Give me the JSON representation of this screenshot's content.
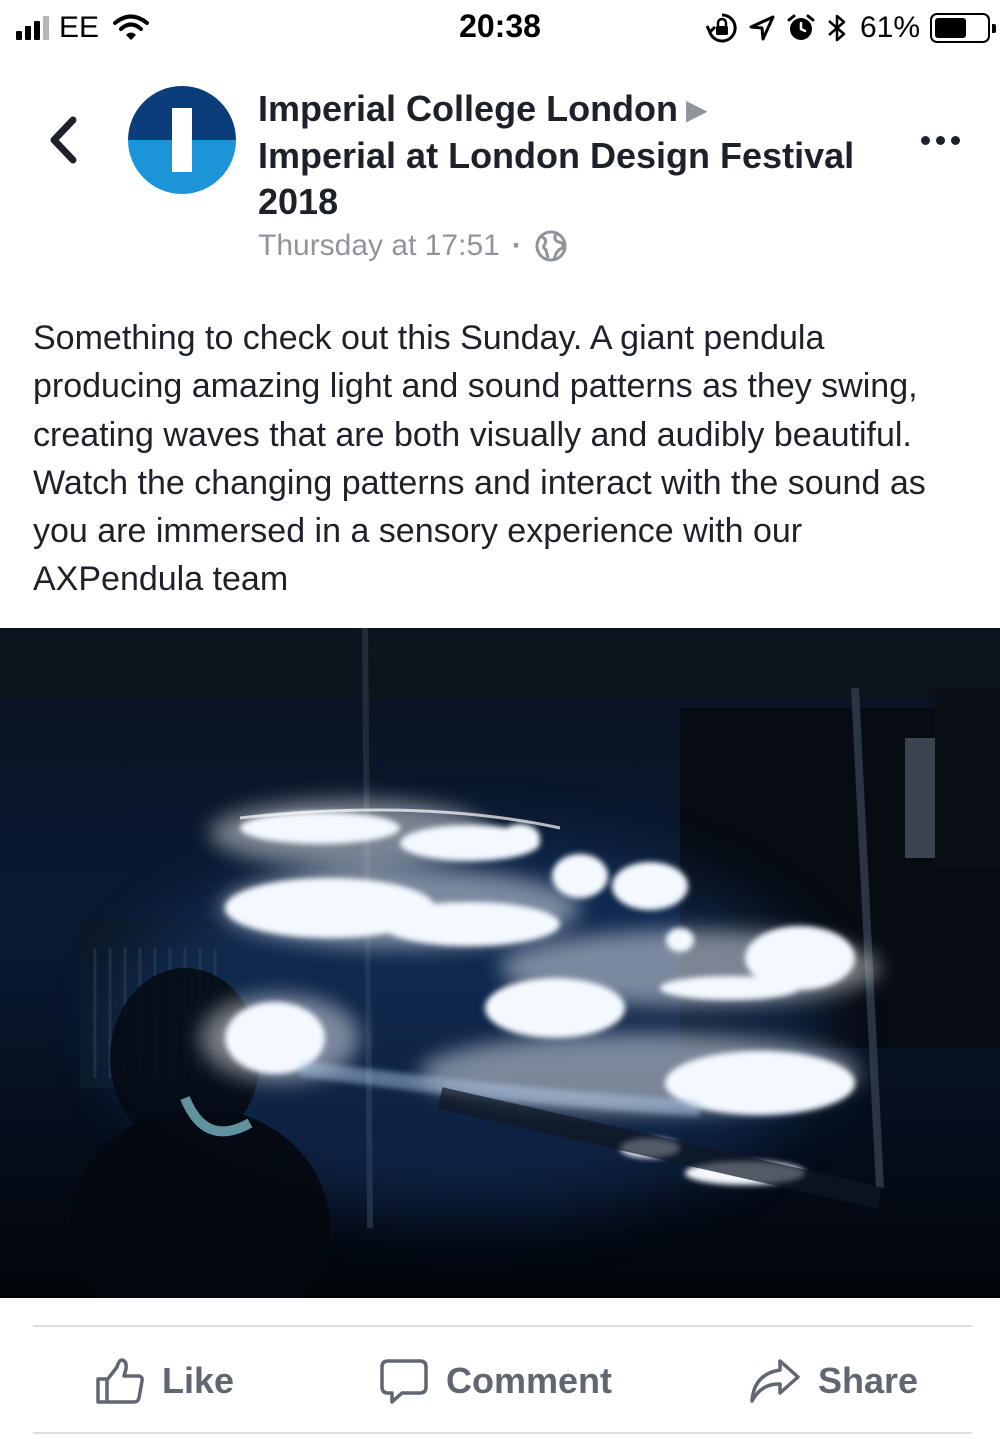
{
  "status_bar": {
    "carrier": "EE",
    "time": "20:38",
    "battery_percent": "61%",
    "battery_level": 0.61,
    "signal_bars": 3,
    "signal_bars_total": 4,
    "icons": [
      "signal-icon",
      "wifi-icon",
      "orientation-lock-icon",
      "location-icon",
      "alarm-icon",
      "bluetooth-icon",
      "battery-icon"
    ]
  },
  "post": {
    "page_name": "Imperial College London",
    "event_name": "Imperial at London Design Festival 2018",
    "timestamp": "Thursday at 17:51",
    "separator": "·",
    "privacy_icon": "globe-icon",
    "text": "Something to check out this Sunday. A giant pendula producing amazing light and sound patterns as they swing, creating waves that are both visually and audibly beautiful. Watch the changing patterns and interact with the sound as you are immersed in a sensory experience with our AXPendula team"
  },
  "colors": {
    "avatar_dark": "#0a3d7a",
    "avatar_light": "#1b95d8",
    "text_primary": "#1d2129",
    "text_secondary": "#90949c",
    "action_text": "#606770",
    "divider": "#dadde1"
  },
  "actions": {
    "like_label": "Like",
    "comment_label": "Comment",
    "share_label": "Share"
  }
}
